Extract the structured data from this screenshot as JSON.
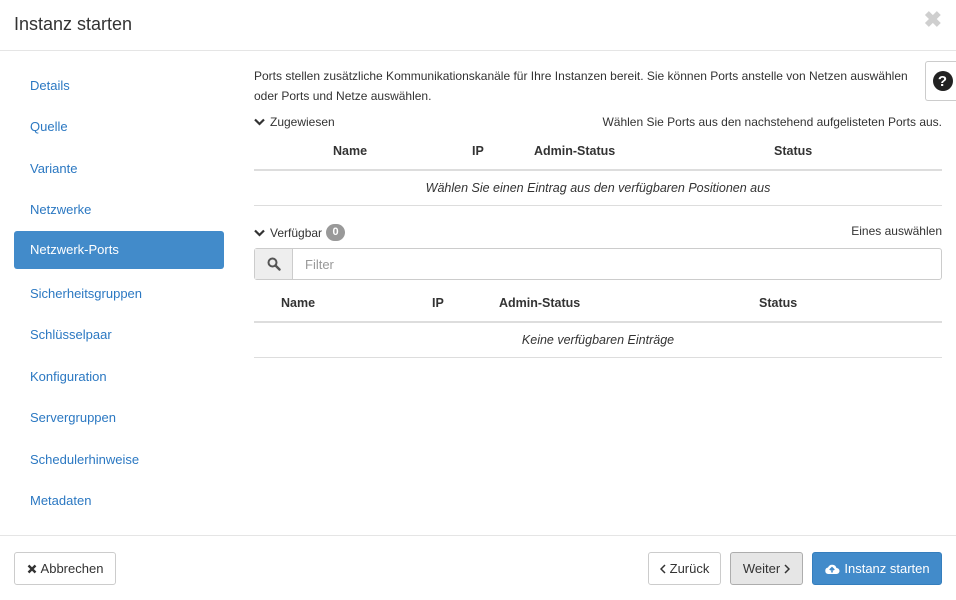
{
  "dialog": {
    "title": "Instanz starten",
    "close_symbol": "✖"
  },
  "sidebar": {
    "items": [
      {
        "label": "Details"
      },
      {
        "label": "Quelle"
      },
      {
        "label": "Variante"
      },
      {
        "label": "Netzwerke"
      },
      {
        "label": "Netzwerk-Ports",
        "active": true
      },
      {
        "label": "Sicherheitsgruppen"
      },
      {
        "label": "Schlüsselpaar"
      },
      {
        "label": "Konfiguration"
      },
      {
        "label": "Servergruppen"
      },
      {
        "label": "Schedulerhinweise"
      },
      {
        "label": "Metadaten"
      }
    ]
  },
  "main": {
    "intro": "Ports stellen zusätzliche Kommunikationskanäle für Ihre Instanzen bereit. Sie können Ports anstelle von Netzen auswählen oder Ports und Netze auswählen.",
    "help_symbol": "?",
    "allocated": {
      "label": "Zugewiesen",
      "hint": "Wählen Sie Ports aus den nachstehend aufgelisteten Ports aus.",
      "columns": [
        "Name",
        "IP",
        "Admin-Status",
        "Status"
      ],
      "empty_text": "Wählen Sie einen Eintrag aus den verfügbaren Positionen aus"
    },
    "available": {
      "label": "Verfügbar",
      "count": "0",
      "hint": "Eines auswählen",
      "filter_placeholder": "Filter",
      "columns": [
        "Name",
        "IP",
        "Admin-Status",
        "Status"
      ],
      "empty_text": "Keine verfügbaren Einträge"
    }
  },
  "footer": {
    "cancel_label": "Abbrechen",
    "back_label": "Zurück",
    "next_label": "Weiter",
    "launch_label": "Instanz starten"
  },
  "colors": {
    "accent": "#428bca",
    "link": "#2b78c2"
  }
}
